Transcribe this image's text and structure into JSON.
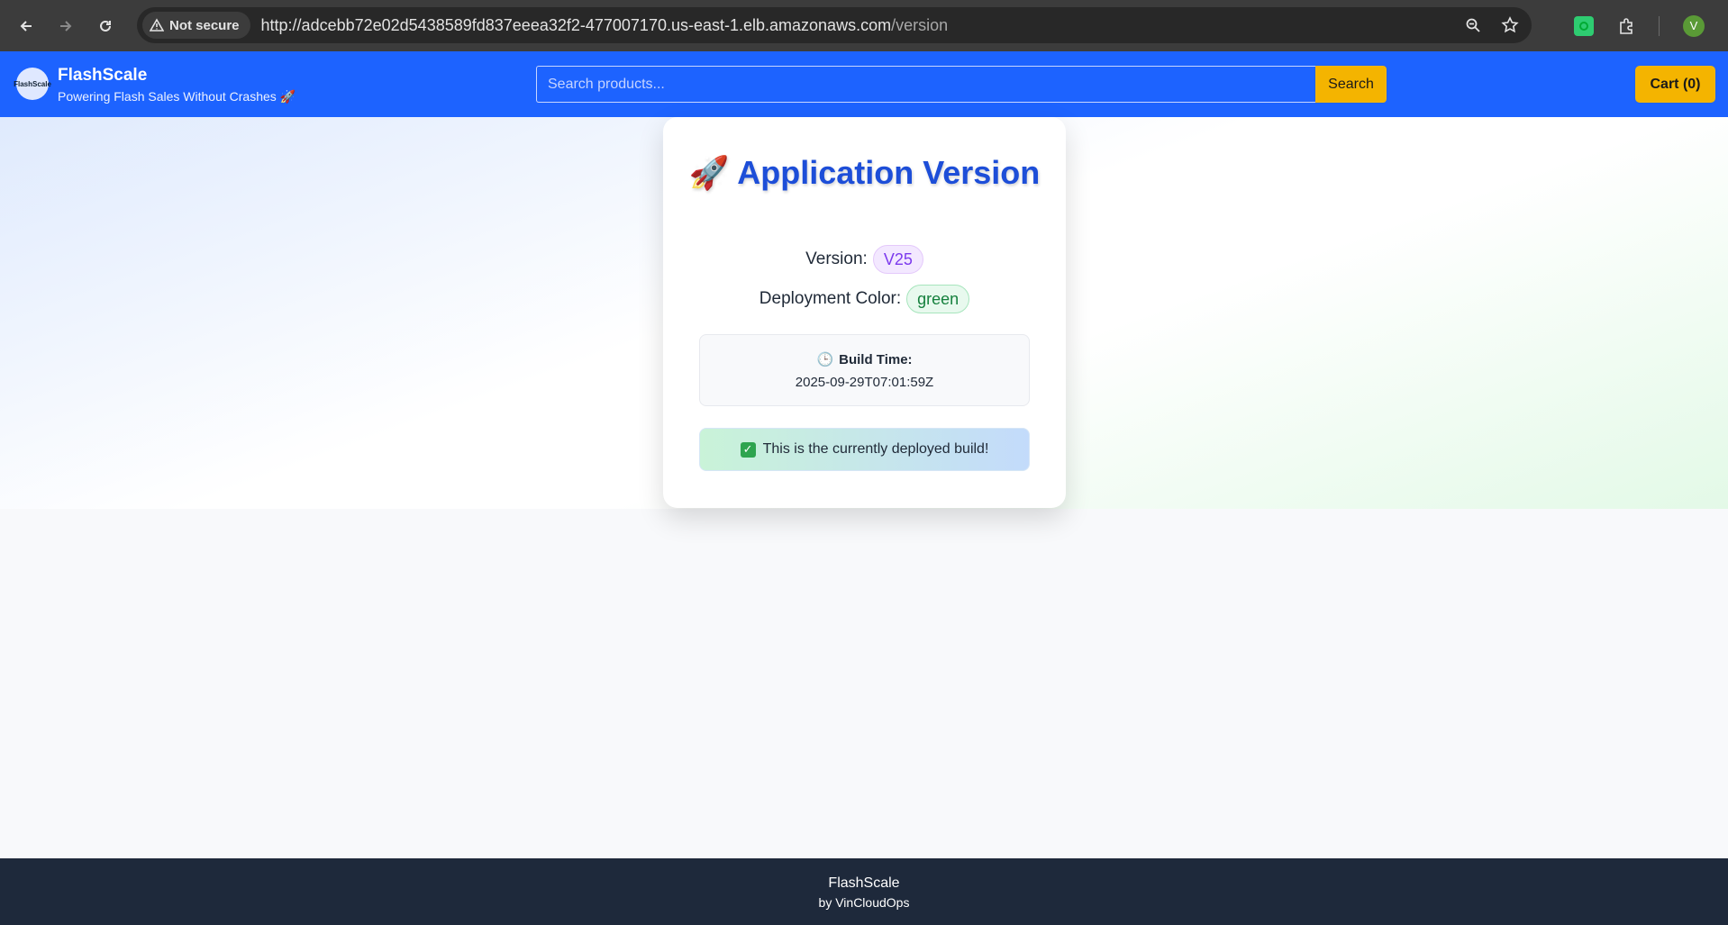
{
  "browser": {
    "security_label": "Not secure",
    "url_host": "http://adcebb72e02d5438589fd837eeea32f2-477007170.us-east-1.elb.amazonaws.com",
    "url_path": "/version",
    "profile_initial": "V",
    "icons": [
      "back-arrow-icon",
      "forward-arrow-icon",
      "reload-icon",
      "warning-icon",
      "zoom-icon",
      "star-icon",
      "extension-icon",
      "puzzle-icon"
    ]
  },
  "header": {
    "logo_text": "FlashScale",
    "brand_name": "FlashScale",
    "tagline": "Powering Flash Sales Without Crashes 🚀",
    "search_placeholder": "Search products...",
    "search_button": "Search",
    "cart_label": "Cart (0)",
    "accent_color": "#1d63ff",
    "button_color": "#f4b400"
  },
  "card": {
    "title_icon": "🚀",
    "title": "Application Version",
    "version_label": "Version:",
    "version_value": "V25",
    "color_label": "Deployment Color:",
    "color_value": "green",
    "build_icon": "🕒",
    "build_label": "Build Time:",
    "build_value": "2025-09-29T07:01:59Z",
    "deploy_message": "This is the currently deployed build!"
  },
  "footer": {
    "name": "FlashScale",
    "by": "by VinCloudOps"
  }
}
